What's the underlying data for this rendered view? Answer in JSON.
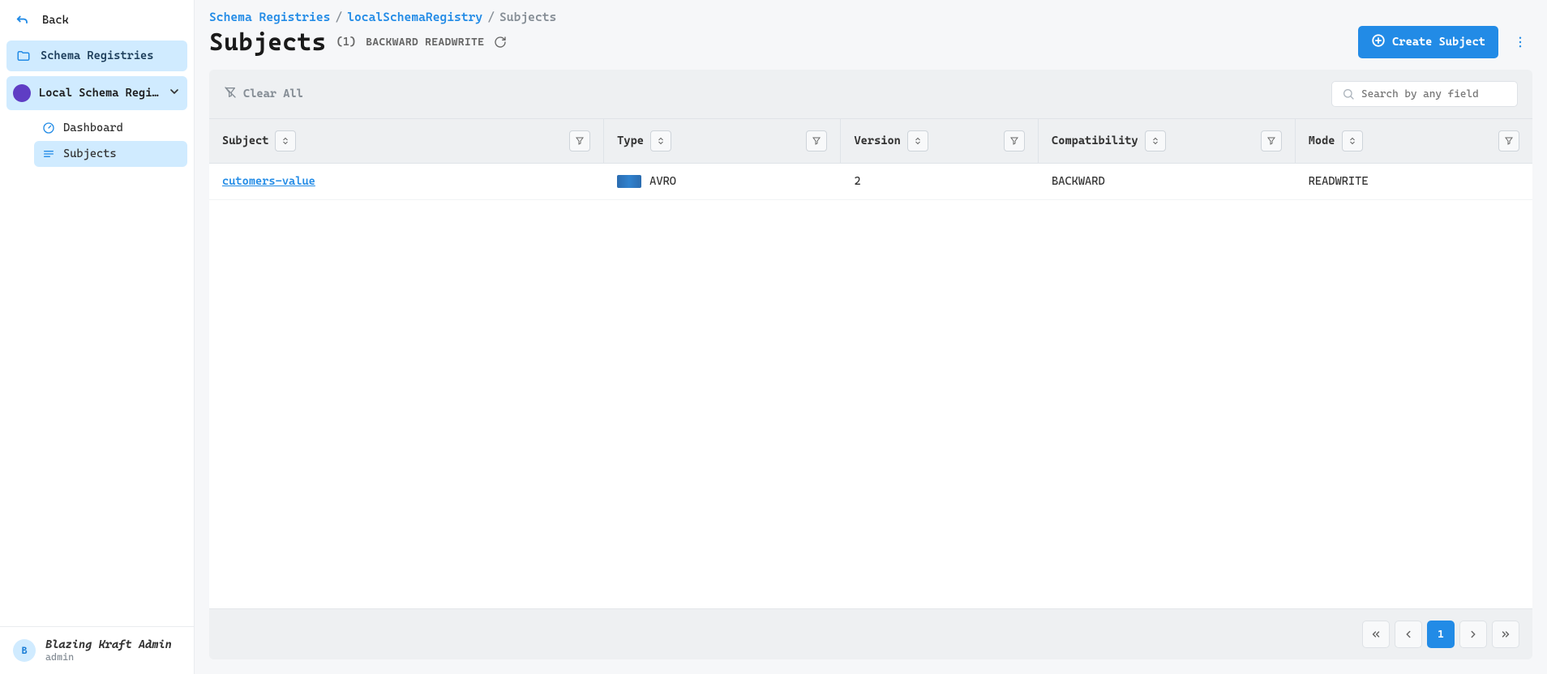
{
  "sidebar": {
    "back_label": "Back",
    "registries_label": "Schema Registries",
    "registry_name": "Local Schema Regi…",
    "items": [
      {
        "label": "Dashboard"
      },
      {
        "label": "Subjects"
      }
    ]
  },
  "user": {
    "initial": "B",
    "name": "Blazing Kraft Admin",
    "role": "admin"
  },
  "breadcrumb": {
    "items": [
      {
        "label": "Schema Registries",
        "link": true
      },
      {
        "label": "localSchemaRegistry",
        "link": true
      },
      {
        "label": "Subjects",
        "link": false
      }
    ]
  },
  "header": {
    "title": "Subjects",
    "count": "(1)",
    "mode": "BACKWARD READWRITE",
    "create_label": "Create Subject"
  },
  "toolbar": {
    "clear_label": "Clear All",
    "search_placeholder": "Search by any field"
  },
  "table": {
    "columns": [
      {
        "label": "Subject"
      },
      {
        "label": "Type"
      },
      {
        "label": "Version"
      },
      {
        "label": "Compatibility"
      },
      {
        "label": "Mode"
      }
    ],
    "rows": [
      {
        "subject": "cutomers-value",
        "type": "AVRO",
        "version": "2",
        "compatibility": "BACKWARD",
        "mode": "READWRITE"
      }
    ]
  },
  "pagination": {
    "current": "1"
  }
}
